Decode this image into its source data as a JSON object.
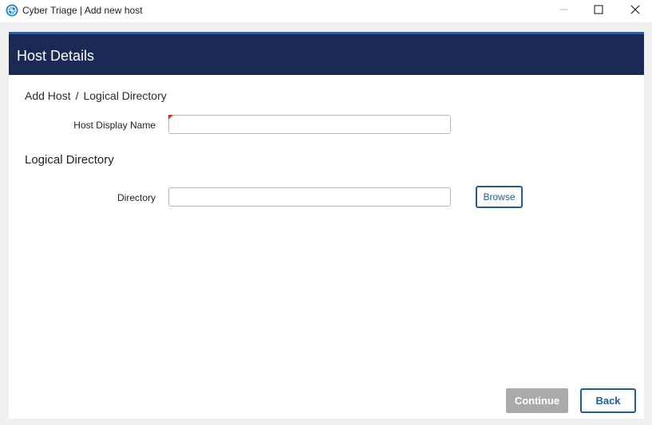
{
  "window": {
    "title": "Cyber Triage | Add new host",
    "app_icon": "cyber-triage-logo-icon",
    "controls": [
      "minimize-icon",
      "maximize-icon",
      "close-icon"
    ]
  },
  "header": {
    "title": "Host Details",
    "background_color": "#1a2a54"
  },
  "breadcrumb": {
    "items": [
      "Add Host",
      "Logical Directory"
    ],
    "separator": "/"
  },
  "form": {
    "host_display_name": {
      "label": "Host Display Name",
      "value": "",
      "required_marker_color": "#e02424"
    },
    "section_title": "Logical Directory",
    "directory": {
      "label": "Directory",
      "value": "",
      "browse_label": "Browse"
    }
  },
  "footer": {
    "continue_label": "Continue",
    "back_label": "Back",
    "accent_color": "#1f5b96"
  }
}
